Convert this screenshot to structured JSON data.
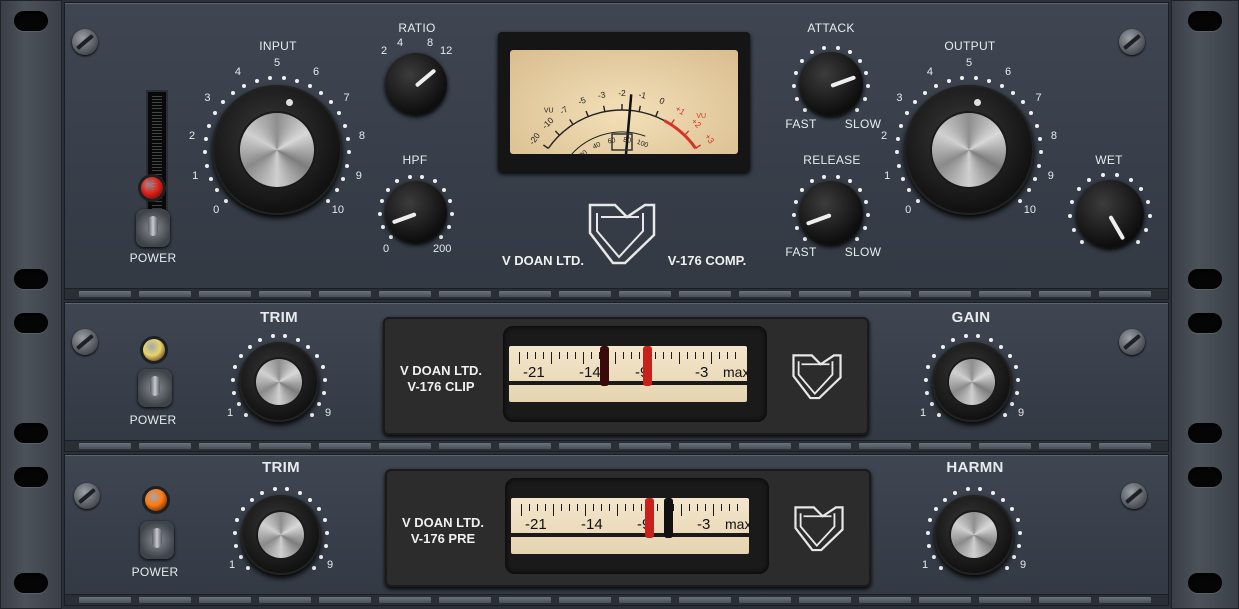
{
  "comp": {
    "input_label": "INPUT",
    "input_scale": [
      "0",
      "1",
      "2",
      "3",
      "4",
      "5",
      "6",
      "7",
      "8",
      "9",
      "10"
    ],
    "ratio_label": "RATIO",
    "ratio_values": [
      "2",
      "4",
      "8",
      "12"
    ],
    "hpf_label": "HPF",
    "hpf_min": "0",
    "hpf_max": "200",
    "attack_label": "ATTACK",
    "release_label": "RELEASE",
    "fast_label": "FAST",
    "slow_label": "SLOW",
    "output_label": "OUTPUT",
    "output_scale": [
      "0",
      "1",
      "2",
      "3",
      "4",
      "5",
      "6",
      "7",
      "8",
      "9",
      "10"
    ],
    "wet_label": "WET",
    "power_label": "POWER",
    "brand_left": "V DOAN LTD.",
    "brand_right": "V-176 COMP.",
    "vu_scale_top": [
      "-20",
      "-10",
      "-7",
      "-5",
      "-3",
      "-2",
      "-1",
      "0",
      "+1",
      "+2",
      "+3"
    ],
    "vu_scale_inner": [
      "0",
      "20",
      "40",
      "60",
      "80",
      "100"
    ],
    "vu_tag_left": "VU",
    "vu_tag_right": "VU",
    "led_color": "#e0211a"
  },
  "clip": {
    "trim_label": "TRIM",
    "gain_label": "GAIN",
    "knob_min": "1",
    "knob_max": "9",
    "power_label": "POWER",
    "brand_line1": "V DOAN LTD.",
    "brand_line2": "V-176 CLIP",
    "scale": [
      "-21",
      "-14",
      "-9",
      "-3",
      "max"
    ],
    "needle_dark_level": 0.4,
    "needle_red_level": 0.58,
    "led_color": "#e8d56a"
  },
  "pre": {
    "trim_label": "TRIM",
    "harmn_label": "HARMN",
    "knob_min": "1",
    "knob_max": "9",
    "power_label": "POWER",
    "brand_line1": "V DOAN LTD.",
    "brand_line2": "V-176 PRE",
    "scale": [
      "-21",
      "-14",
      "-9",
      "-3",
      "max"
    ],
    "needle_red_level": 0.58,
    "needle_dark_level": 0.66,
    "led_color": "#ff7a10"
  }
}
